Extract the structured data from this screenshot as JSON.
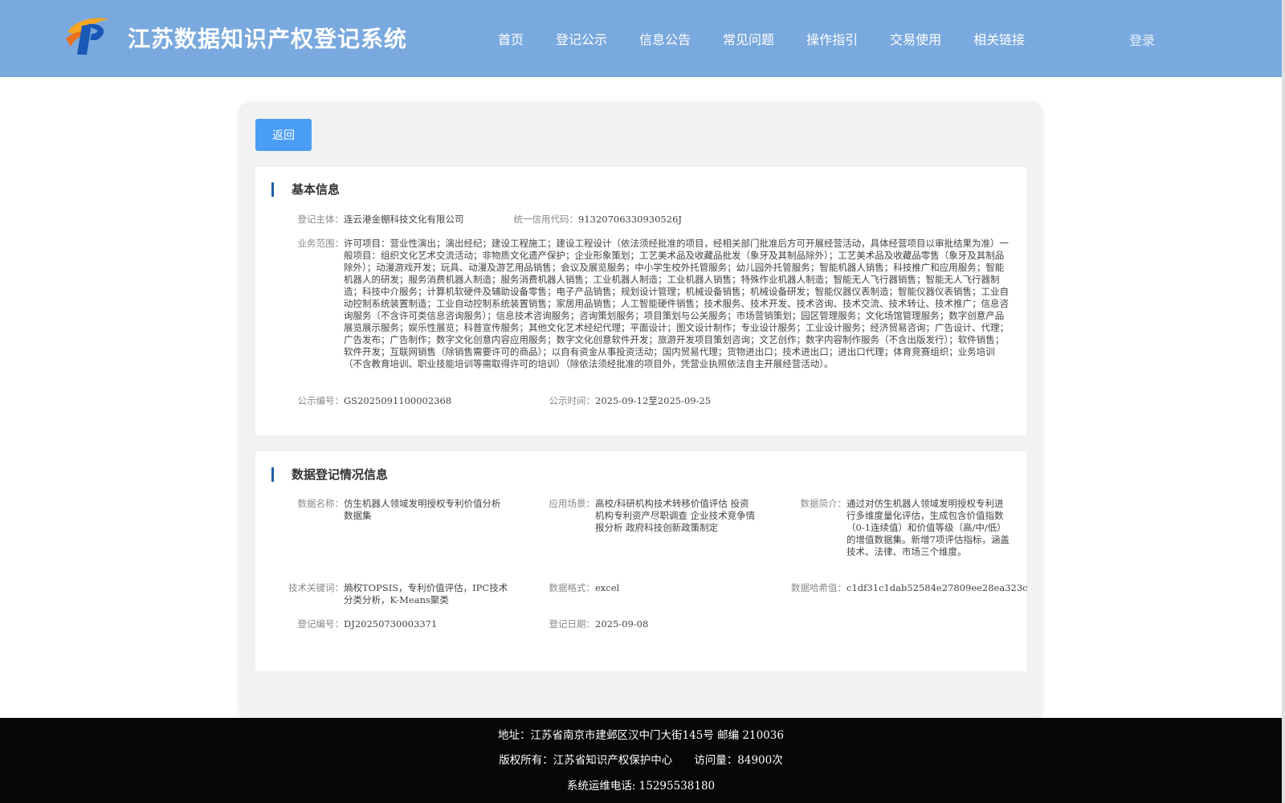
{
  "header": {
    "site_title": "江苏数据知识产权登记系统",
    "nav": [
      "首页",
      "登记公示",
      "信息公告",
      "常见问题",
      "操作指引",
      "交易使用",
      "相关链接"
    ],
    "login": "登录",
    "bg_color": "#79a9de"
  },
  "back_button": "返回",
  "basic_info": {
    "title": "基本信息",
    "entity_label": "登记主体：",
    "entity_value": "连云港金棚科技文化有限公司",
    "credit_label": "统一信用代码：",
    "credit_value": "91320706330930526J",
    "scope_label": "业务范围：",
    "scope_value": "许可项目：营业性演出；演出经纪；建设工程施工；建设工程设计（依法须经批准的项目，经相关部门批准后方可开展经营活动，具体经营项目以审批结果为准）一般项目：组织文化艺术交流活动；非物质文化遗产保护；企业形象策划；工艺美术品及收藏品批发（象牙及其制品除外）；工艺美术品及收藏品零售（象牙及其制品除外）；动漫游戏开发；玩具、动漫及游艺用品销售；会议及展览服务；中小学生校外托管服务；幼儿园外托管服务；智能机器人销售；科技推广和应用服务；智能机器人的研发；服务消费机器人制造；服务消费机器人销售；工业机器人制造；工业机器人销售；特殊作业机器人制造；智能无人飞行器销售；智能无人飞行器制造；科技中介服务；计算机软硬件及辅助设备零售；电子产品销售；规划设计管理；机械设备销售；机械设备研发；智能仪器仪表制造；智能仪器仪表销售；工业自动控制系统装置制造；工业自动控制系统装置销售；家居用品销售；人工智能硬件销售；技术服务、技术开发、技术咨询、技术交流、技术转让、技术推广；信息咨询服务（不含许可类信息咨询服务）；信息技术咨询服务；咨询策划服务；项目策划与公关服务；市场营销策划；园区管理服务；文化场馆管理服务；数字创意产品展览展示服务；娱乐性展览；科普宣传服务；其他文化艺术经纪代理；平面设计；图文设计制作；专业设计服务；工业设计服务；经济贸易咨询；广告设计、代理；广告发布；广告制作；数字文化创意内容应用服务；数字文化创意软件开发；旅游开发项目策划咨询；文艺创作；数字内容制作服务（不含出版发行）；软件销售；软件开发；互联网销售（除销售需要许可的商品）；以自有资金从事投资活动；国内贸易代理；货物进出口；技术进出口；进出口代理；体育竞赛组织；业务培训（不含教育培训、职业技能培训等需取得许可的培训）（除依法须经批准的项目外，凭营业执照依法自主开展经营活动）。",
    "pub_no_label": "公示编号：",
    "pub_no_value": "GS2025091100002368",
    "pub_time_label": "公示时间：",
    "pub_time_value": "2025-09-12至2025-09-25"
  },
  "data_info": {
    "title": "数据登记情况信息",
    "name_label": "数据名称：",
    "name_value": "仿生机器人领域发明授权专利价值分析数据集",
    "scene_label": "应用场景：",
    "scene_value": "高校/科研机构技术转移价值评估 投资机构专利资产尽职调查 企业技术竞争情报分析 政府科技创新政策制定",
    "intro_label": "数据简介：",
    "intro_value": "通过对仿生机器人领域发明授权专利进行多维度量化评估，生成包含价值指数（0-1连续值）和价值等级（高/中/低）的增值数据集。新增7项评估指标，涵盖技术、法律、市场三个维度。",
    "keywords_label": "技术关键词：",
    "keywords_value": "熵权TOPSIS，专利价值评估，IPC技术分类分析，K-Means聚类",
    "format_label": "数据格式：",
    "format_value": "excel",
    "hash_label": "数据哈希值：",
    "hash_value": "c1df31c1dab52584e27809ee28ea323c",
    "reg_no_label": "登记编号：",
    "reg_no_value": "DJ20250730003371",
    "reg_date_label": "登记日期：",
    "reg_date_value": "2025-09-08"
  },
  "footer": {
    "address": "地址：江苏省南京市建邺区汉中门大街145号 邮编 210036",
    "copyright": "版权所有：江苏省知识产权保护中心　　访问量：84900次",
    "phone": "系统运维电话: 15295538180"
  }
}
